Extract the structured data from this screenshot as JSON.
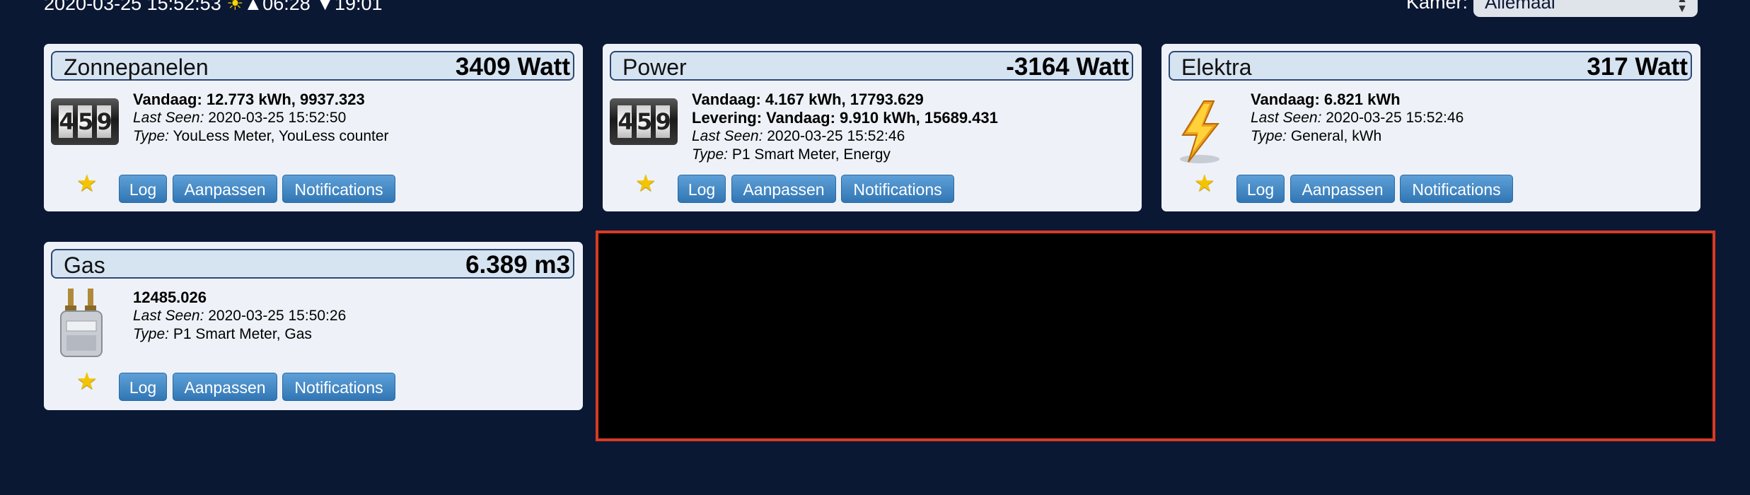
{
  "topbar": {
    "datetime": "2020-03-25 15:52:53",
    "sun_symbol": "☀",
    "sunrise": "▲06:28",
    "sunset": "▼19:01",
    "room_label": "Kamer:",
    "room_value": "Allemaal"
  },
  "buttons": {
    "log": "Log",
    "edit": "Aanpassen",
    "notifications": "Notifications"
  },
  "labels": {
    "last_seen": "Last Seen:",
    "type": "Type:"
  },
  "cards": [
    {
      "name": "Zonnepanelen",
      "value": "3409 Watt",
      "icon": "counter-meter-icon",
      "line1": "Vandaag: 12.773 kWh, 9937.323",
      "last_seen": "2020-03-25 15:52:50",
      "type": "YouLess Meter, YouLess counter"
    },
    {
      "name": "Power",
      "value": "-3164 Watt",
      "icon": "counter-meter-icon",
      "line1": "Vandaag: 4.167 kWh, 17793.629",
      "line2": "Levering: Vandaag: 9.910 kWh, 15689.431",
      "last_seen": "2020-03-25 15:52:46",
      "type": "P1 Smart Meter, Energy"
    },
    {
      "name": "Elektra",
      "value": "317 Watt",
      "icon": "lightning-icon",
      "line1": "Vandaag: 6.821 kWh",
      "last_seen": "2020-03-25 15:52:46",
      "type": "General, kWh"
    },
    {
      "name": "Gas",
      "value": "6.389 m3",
      "icon": "gas-meter-icon",
      "line1": "12485.026",
      "last_seen": "2020-03-25 15:50:26",
      "type": "P1 Smart Meter, Gas"
    }
  ],
  "colors": {
    "background": "#0b1834",
    "card": "#eef2f8",
    "button": "#3b82c4",
    "redaction_border": "#d83a26"
  }
}
